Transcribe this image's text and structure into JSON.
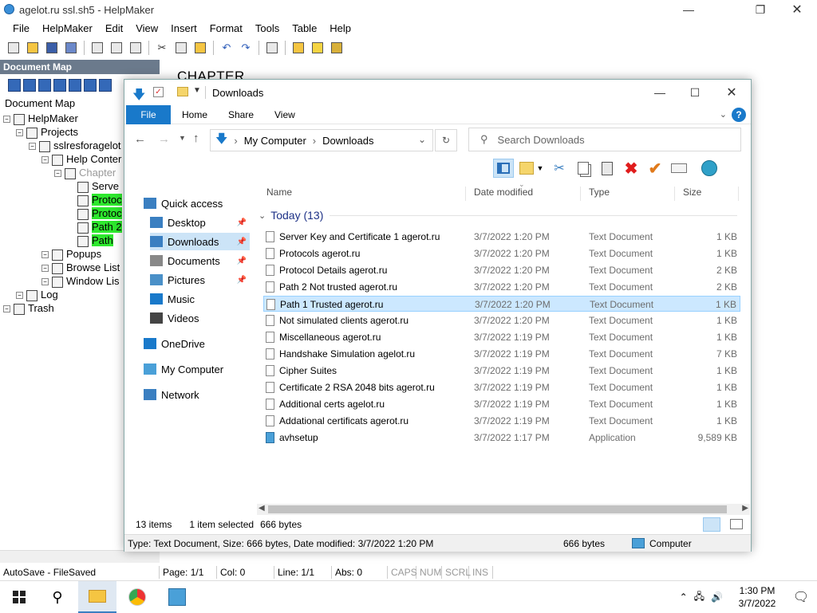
{
  "helpmaker": {
    "title": "agelot.ru ssl.sh5 - HelpMaker",
    "menu": [
      "File",
      "HelpMaker",
      "Edit",
      "View",
      "Insert",
      "Format",
      "Tools",
      "Table",
      "Help"
    ],
    "docmap_header": "Document Map",
    "docmap_label": "Document Map",
    "chapter_heading": "CHAPTER",
    "tree": [
      {
        "label": "HelpMaker",
        "indent": 0
      },
      {
        "label": "Projects",
        "indent": 1
      },
      {
        "label": "sslresforagelot",
        "indent": 2
      },
      {
        "label": "Help Conter",
        "indent": 3
      },
      {
        "label": "Chapter",
        "indent": 4
      },
      {
        "label": "Serve",
        "indent": 5
      },
      {
        "label": "Protoc",
        "indent": 5
      },
      {
        "label": "Protoc",
        "indent": 5
      },
      {
        "label": "Path 2",
        "indent": 5
      },
      {
        "label": "Path",
        "indent": 5
      },
      {
        "label": "Popups",
        "indent": 3
      },
      {
        "label": "Browse List",
        "indent": 3
      },
      {
        "label": "Window Lis",
        "indent": 3
      },
      {
        "label": "Log",
        "indent": 1
      },
      {
        "label": "Trash",
        "indent": 0
      }
    ],
    "status": [
      "AutoSave - FileSaved",
      "Page: 1/1",
      "Col: 0",
      "Line: 1/1",
      "Abs: 0",
      "CAPS",
      "NUM",
      "SCRL",
      "INS"
    ]
  },
  "explorer": {
    "title": "Downloads",
    "ribbon_tabs": [
      "File",
      "Home",
      "Share",
      "View"
    ],
    "help": "?",
    "breadcrumb": [
      "My Computer",
      "Downloads"
    ],
    "search_placeholder": "Search Downloads",
    "nav": [
      {
        "label": "Quick access",
        "pinned": false
      },
      {
        "label": "Desktop",
        "pinned": true
      },
      {
        "label": "Downloads",
        "pinned": true
      },
      {
        "label": "Documents",
        "pinned": true
      },
      {
        "label": "Pictures",
        "pinned": true
      },
      {
        "label": "Music",
        "pinned": false
      },
      {
        "label": "Videos",
        "pinned": false
      },
      {
        "label": "OneDrive",
        "pinned": false
      },
      {
        "label": "My Computer",
        "pinned": false
      },
      {
        "label": "Network",
        "pinned": false
      }
    ],
    "columns": [
      "Name",
      "Date modified",
      "Type",
      "Size"
    ],
    "group": "Today (13)",
    "files": [
      {
        "name": "Server Key and Certificate 1 agerot.ru",
        "date": "3/7/2022 1:20 PM",
        "type": "Text Document",
        "size": "1 KB"
      },
      {
        "name": "Protocols agerot.ru",
        "date": "3/7/2022 1:20 PM",
        "type": "Text Document",
        "size": "1 KB"
      },
      {
        "name": "Protocol Details agerot.ru",
        "date": "3/7/2022 1:20 PM",
        "type": "Text Document",
        "size": "2 KB"
      },
      {
        "name": "Path 2 Not trusted agerot.ru",
        "date": "3/7/2022 1:20 PM",
        "type": "Text Document",
        "size": "2 KB"
      },
      {
        "name": "Path 1 Trusted agerot.ru",
        "date": "3/7/2022 1:20 PM",
        "type": "Text Document",
        "size": "1 KB"
      },
      {
        "name": "Not simulated clients agerot.ru",
        "date": "3/7/2022 1:20 PM",
        "type": "Text Document",
        "size": "1 KB"
      },
      {
        "name": "Miscellaneous agerot.ru",
        "date": "3/7/2022 1:19 PM",
        "type": "Text Document",
        "size": "1 KB"
      },
      {
        "name": "Handshake Simulation agelot.ru",
        "date": "3/7/2022 1:19 PM",
        "type": "Text Document",
        "size": "7 KB"
      },
      {
        "name": "Cipher Suites",
        "date": "3/7/2022 1:19 PM",
        "type": "Text Document",
        "size": "1 KB"
      },
      {
        "name": "Certificate 2 RSA 2048 bits agerot.ru",
        "date": "3/7/2022 1:19 PM",
        "type": "Text Document",
        "size": "1 KB"
      },
      {
        "name": "Additional certs agelot.ru",
        "date": "3/7/2022 1:19 PM",
        "type": "Text Document",
        "size": "1 KB"
      },
      {
        "name": "Addational certificats  agerot.ru",
        "date": "3/7/2022 1:19 PM",
        "type": "Text Document",
        "size": "1 KB"
      },
      {
        "name": "avhsetup",
        "date": "3/7/2022 1:17 PM",
        "type": "Application",
        "size": "9,589 KB"
      }
    ],
    "selected_index": 4,
    "status_items": "13 items",
    "status_selected": "1 item selected",
    "status_bytes": "666 bytes",
    "details": "Type: Text Document, Size: 666 bytes, Date modified: 3/7/2022 1:20 PM",
    "details_size": "666 bytes",
    "details_location": "Computer"
  },
  "taskbar": {
    "time": "1:30 PM",
    "date": "3/7/2022"
  },
  "colors": {
    "accent": "#1979ca",
    "selection": "#cce8ff",
    "highlight": "#2ee82e"
  }
}
